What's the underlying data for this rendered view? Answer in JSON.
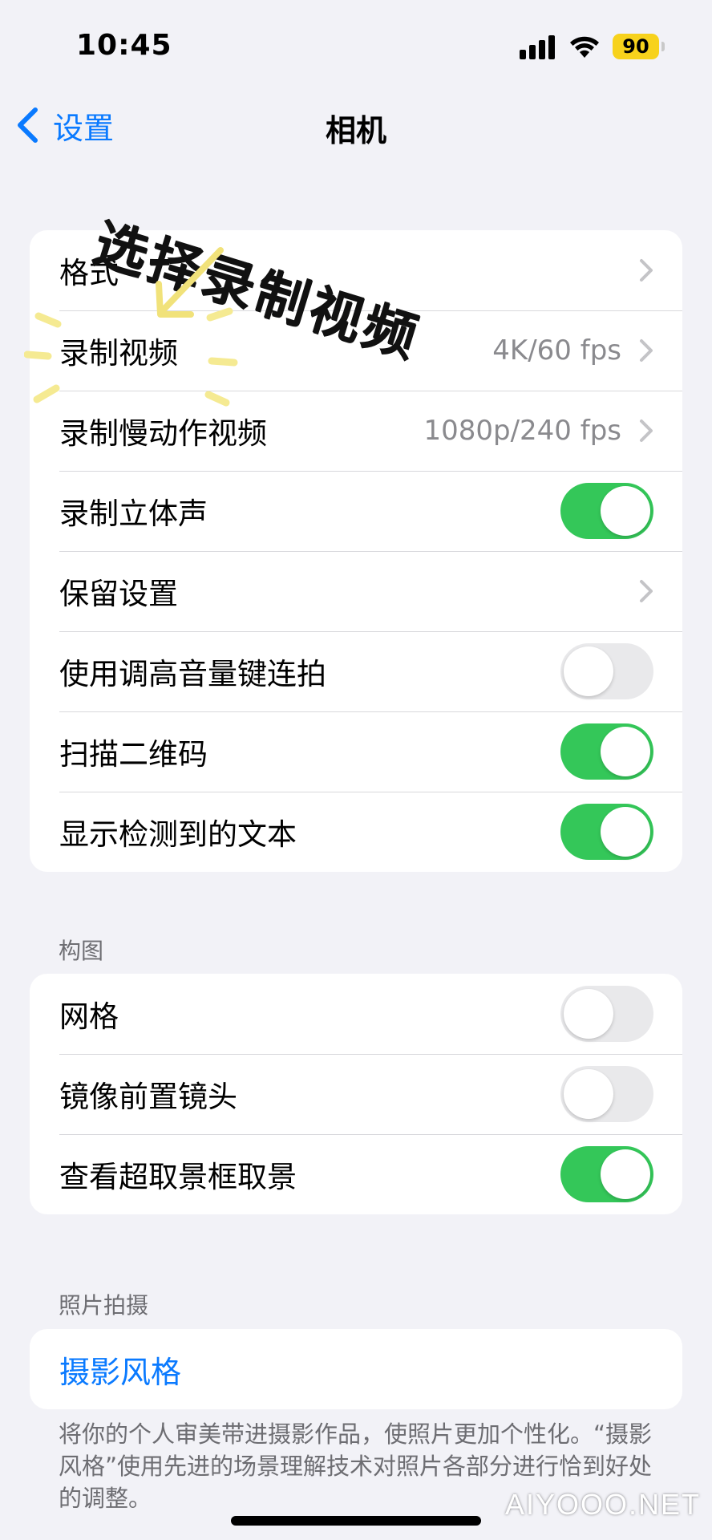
{
  "status_bar": {
    "time": "10:45",
    "battery": "90"
  },
  "nav": {
    "back_label": "设置",
    "title": "相机"
  },
  "annotation": {
    "text": "选择录制视频"
  },
  "group1": [
    {
      "label": "格式",
      "value": "",
      "control": "chevron"
    },
    {
      "label": "录制视频",
      "value": "4K/60 fps",
      "control": "chevron"
    },
    {
      "label": "录制慢动作视频",
      "value": "1080p/240 fps",
      "control": "chevron"
    },
    {
      "label": "录制立体声",
      "control": "toggle",
      "on": true
    },
    {
      "label": "保留设置",
      "value": "",
      "control": "chevron"
    },
    {
      "label": "使用调高音量键连拍",
      "control": "toggle",
      "on": false
    },
    {
      "label": "扫描二维码",
      "control": "toggle",
      "on": true
    },
    {
      "label": "显示检测到的文本",
      "control": "toggle",
      "on": true
    }
  ],
  "composition": {
    "header": "构图",
    "rows": [
      {
        "label": "网格",
        "on": false
      },
      {
        "label": "镜像前置镜头",
        "on": false
      },
      {
        "label": "查看超取景框取景",
        "on": true
      }
    ]
  },
  "photo_capture": {
    "header": "照片拍摄",
    "link_label": "摄影风格",
    "footer": "将你的个人审美带进摄影作品，使照片更加个性化。“摄影风格”使用先进的场景理解技术对照片各部分进行恰到好处的调整。"
  },
  "watermark": "AIYOOO.NET",
  "colors": {
    "accent": "#0a7aff",
    "toggle_on": "#34c759",
    "battery": "#f7d21c"
  }
}
